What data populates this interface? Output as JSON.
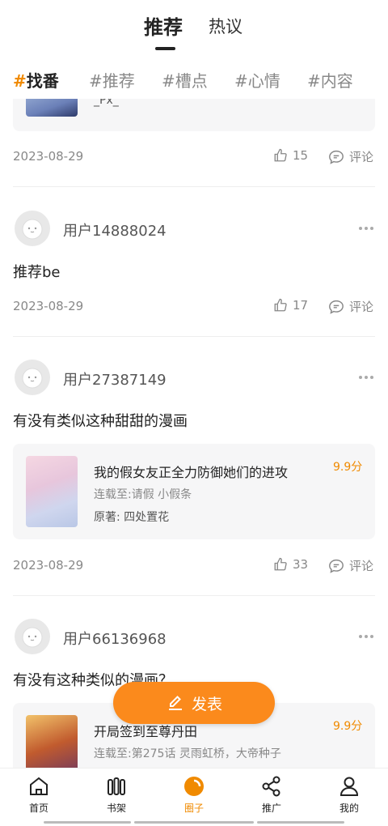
{
  "top_tabs": {
    "active": "推荐",
    "inactive": "热议"
  },
  "filters": [
    {
      "hash": "#",
      "label": "找番"
    },
    {
      "hash": "#",
      "label": "推荐"
    },
    {
      "hash": "#",
      "label": "槽点"
    },
    {
      "hash": "#",
      "label": "心情"
    },
    {
      "hash": "#",
      "label": "内容"
    }
  ],
  "post0": {
    "card_text": "_Px_",
    "date": "2023-08-29",
    "likes": "15",
    "comment_label": "评论"
  },
  "post1": {
    "user": "用户14888024",
    "text": "推荐be",
    "date": "2023-08-29",
    "likes": "17",
    "comment_label": "评论"
  },
  "post2": {
    "user": "用户27387149",
    "text": "有没有类似这种甜甜的漫画",
    "book": {
      "title": "我的假女友正全力防御她们的进攻",
      "score": "9.9分",
      "serial": "连载至:请假 小假条",
      "author": "原著: 四处置花"
    },
    "date": "2023-08-29",
    "likes": "33",
    "comment_label": "评论"
  },
  "post3": {
    "user": "用户66136968",
    "text": "有没有这种类似的漫画？",
    "book": {
      "title": "开局签到至尊丹田",
      "score": "9.9分",
      "serial": "连载至:第275话 灵雨虹桥，大帝种子"
    }
  },
  "publish_label": "发表",
  "nav": [
    {
      "label": "首页",
      "icon": "home-icon"
    },
    {
      "label": "书架",
      "icon": "bookshelf-icon"
    },
    {
      "label": "圈子",
      "icon": "circle-icon"
    },
    {
      "label": "推广",
      "icon": "share-icon"
    },
    {
      "label": "我的",
      "icon": "profile-icon"
    }
  ],
  "colors": {
    "accent": "#f08a00",
    "publish_bg": "#fb8a1c"
  }
}
